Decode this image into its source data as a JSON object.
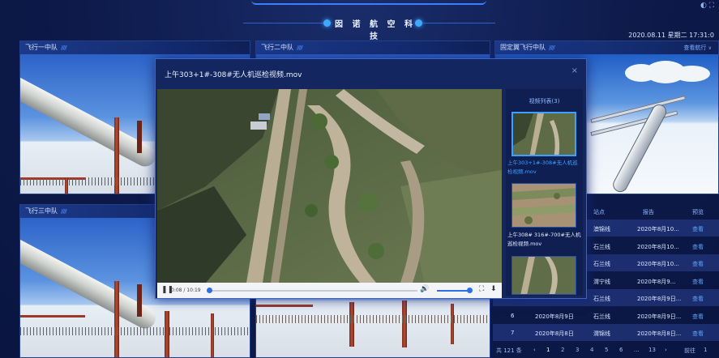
{
  "header": {
    "title": "囡 诺 航 空 科 技",
    "datetime": "2020.08.11 星期二 17:31:0",
    "corner_icons": "◐ ⛶"
  },
  "panels": {
    "p1": {
      "title": "飞行一中队",
      "stripes": "/////"
    },
    "p2": {
      "title": "飞行二中队",
      "stripes": "/////"
    },
    "p3": {
      "title": "飞行三中队",
      "stripes": "/////"
    },
    "p4": {
      "title": "固定翼飞行中队",
      "stripes": "/////",
      "more": "查看航行"
    }
  },
  "table": {
    "headers": {
      "num": "",
      "date": "",
      "station": "站点",
      "report": "报告",
      "view": "预览"
    },
    "rows": [
      {
        "num": "",
        "date": "",
        "station": "澳锦线",
        "report": "2020年8月10...",
        "view": "查看"
      },
      {
        "num": "",
        "date": "",
        "station": "石兰线",
        "report": "2020年8月10...",
        "view": "查看"
      },
      {
        "num": "",
        "date": "",
        "station": "石兰线",
        "report": "2020年8月10...",
        "view": "查看"
      },
      {
        "num": "",
        "date": "",
        "station": "渭宁线",
        "report": "2020年8月9...",
        "view": "查看"
      },
      {
        "num": "",
        "date": "",
        "station": "石兰线",
        "report": "2020年8月9日...",
        "view": "查看"
      },
      {
        "num": "6",
        "date": "2020年8月9日",
        "station": "石兰线",
        "report": "2020年8月9日...",
        "view": "查看"
      },
      {
        "num": "7",
        "date": "2020年8月8日",
        "station": "渭锦线",
        "report": "2020年8月8日...",
        "view": "查看"
      }
    ],
    "pager": {
      "total": "共 121 条",
      "prev": "‹",
      "pages": [
        "1",
        "2",
        "3",
        "4",
        "5",
        "6",
        "...",
        "13"
      ],
      "next": "›",
      "goto": "前往",
      "goto_value": "1"
    }
  },
  "modal": {
    "title": "上午303+1#-308#无人机巡检视频.mov",
    "close": "×",
    "controls": {
      "play_icon": "❚❚",
      "time": "0:08 / 10:19",
      "progress": 0.012,
      "volume": 0.9,
      "volume_icon": "🔊",
      "fullscreen_icon": "⛶",
      "download_icon": "⬇"
    },
    "list": {
      "heading": "视频列表(3)",
      "items": [
        {
          "caption": "上午303+1#-308#无人机巡检视频.mov",
          "selected": true
        },
        {
          "caption": "上午308# 316#-700#无人机巡检视频.mov",
          "selected": false
        }
      ]
    }
  },
  "colors": {
    "accent": "#3da0ff",
    "background": "#0d1a4a",
    "panel_header": "#1c3a8a"
  }
}
